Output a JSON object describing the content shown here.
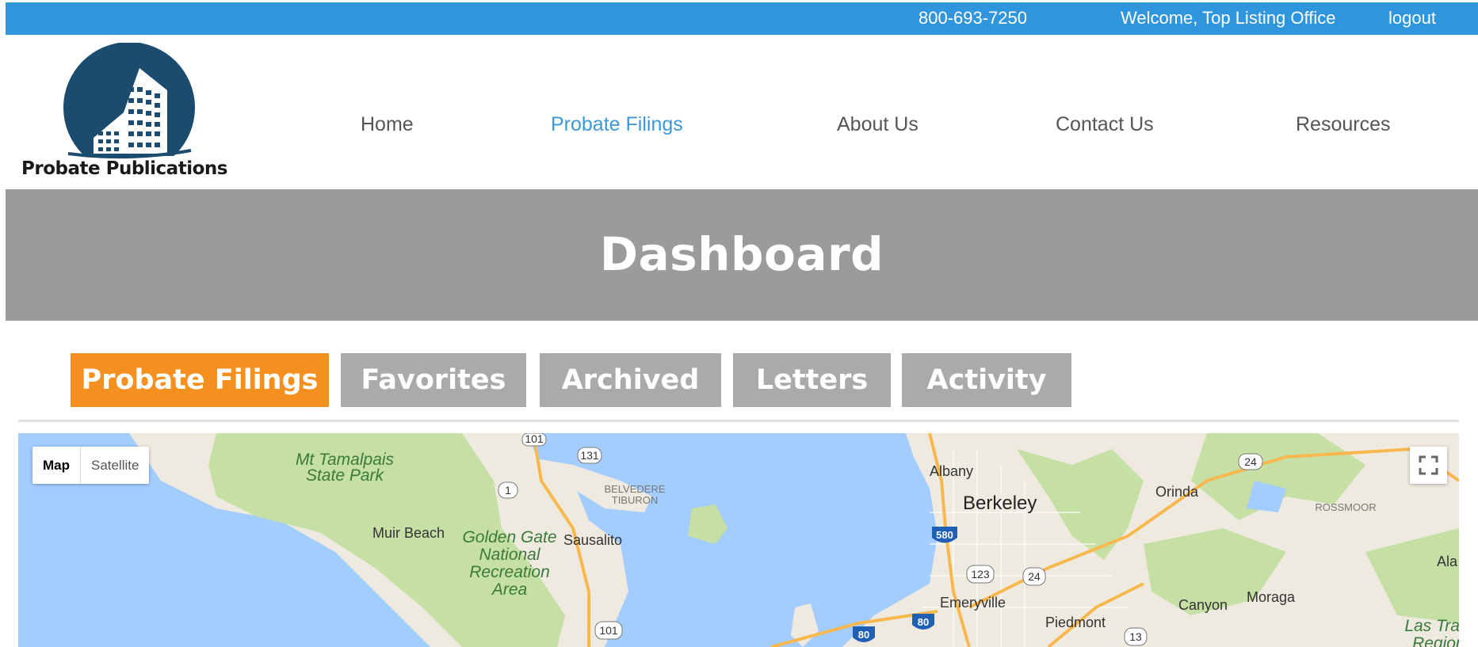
{
  "topbar": {
    "phone": "800-693-7250",
    "welcome": "Welcome, Top Listing Office",
    "logout": "logout"
  },
  "logo": {
    "brand_text": "Probate Publications"
  },
  "nav": {
    "items": [
      {
        "label": "Home"
      },
      {
        "label": "Probate Filings",
        "active": true
      },
      {
        "label": "About Us"
      },
      {
        "label": "Contact Us"
      },
      {
        "label": "Resources"
      }
    ]
  },
  "hero": {
    "title": "Dashboard"
  },
  "tabs": [
    {
      "label": "Probate Filings",
      "active": true
    },
    {
      "label": "Favorites"
    },
    {
      "label": "Archived"
    },
    {
      "label": "Letters"
    },
    {
      "label": "Activity"
    }
  ],
  "map": {
    "type_controls": {
      "map": "Map",
      "satellite": "Satellite"
    },
    "places": {
      "mt_tamalpais_1": "Mt Tamalpais",
      "mt_tamalpais_2": "State Park",
      "muir_beach": "Muir Beach",
      "ggnra_1": "Golden Gate",
      "ggnra_2": "National",
      "ggnra_3": "Recreation",
      "ggnra_4": "Area",
      "sausalito": "Sausalito",
      "belvedere_1": "BELVEDERE",
      "belvedere_2": "TIBURON",
      "albany": "Albany",
      "berkeley": "Berkeley",
      "orinda": "Orinda",
      "rossmoor": "ROSSMOOR",
      "emeryville": "Emeryville",
      "piedmont": "Piedmont",
      "canyon": "Canyon",
      "moraga": "Moraga",
      "las_trampas_1": "Las Tran",
      "las_trampas_2": "Regior",
      "ala": "Ala"
    },
    "shields": {
      "s101_top": "101",
      "s131": "131",
      "s1": "1",
      "s101_bottom": "101",
      "s24_top": "24",
      "s580": "580",
      "s123": "123",
      "s24_mid": "24",
      "s13": "13",
      "s80_left": "80",
      "s80_right": "80"
    },
    "colors": {
      "water": "#a3ccff",
      "land": "#f0ede5",
      "park": "#c6dfa4",
      "highway": "#f8b84e"
    }
  },
  "colors": {
    "topbar": "#2f96dd",
    "nav_active": "#3d98d8",
    "hero": "#9b9b9b",
    "tab_active": "#f4901f",
    "tab_inactive": "#aaaaaa",
    "logo_circle": "#1b4b6e"
  }
}
